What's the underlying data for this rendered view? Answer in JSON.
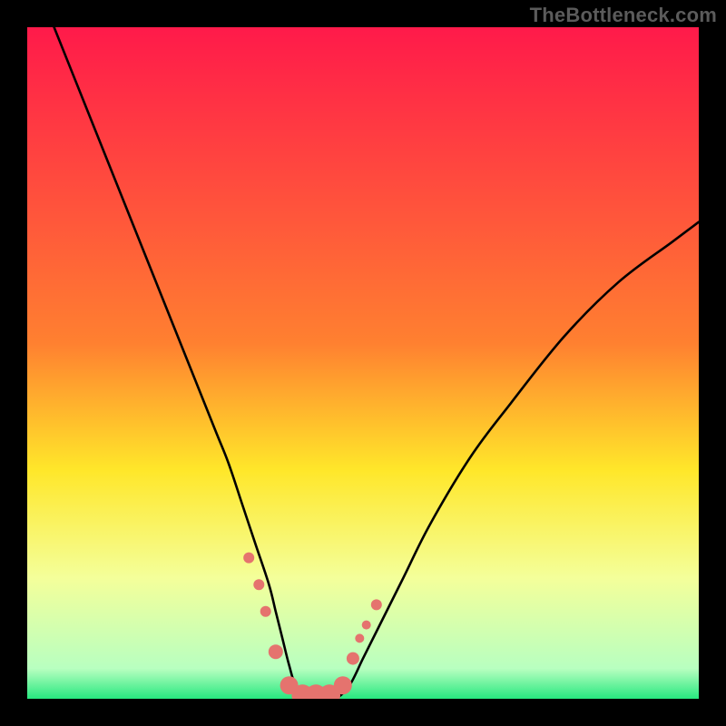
{
  "watermark": "TheBottleneck.com",
  "chart_data": {
    "type": "line",
    "title": "",
    "xlabel": "",
    "ylabel": "",
    "xlim": [
      0,
      100
    ],
    "ylim": [
      0,
      100
    ],
    "grid": false,
    "legend": false,
    "background_gradient": {
      "top": "#FF1A4A",
      "mid1": "#FF8030",
      "mid2": "#FFE72A",
      "low": "#F4FF9A",
      "bottom": "#27E87F"
    },
    "series": [
      {
        "name": "curve",
        "stroke": "#000000",
        "x": [
          4,
          8,
          12,
          16,
          20,
          24,
          28,
          30,
          32,
          34,
          36,
          37,
          38,
          39,
          40,
          42,
          44,
          45,
          46,
          48,
          50,
          52,
          56,
          60,
          66,
          72,
          80,
          88,
          96,
          100
        ],
        "y": [
          100,
          90,
          80,
          70,
          60,
          50,
          40,
          35,
          29,
          23,
          17,
          13,
          9,
          5,
          2,
          0,
          0,
          0,
          0,
          2,
          6,
          10,
          18,
          26,
          36,
          44,
          54,
          62,
          68,
          71
        ]
      },
      {
        "name": "markers",
        "type": "scatter",
        "color": "#E5736E",
        "x": [
          33,
          34.5,
          35.5,
          37,
          39,
          41,
          43,
          45,
          47,
          48.5,
          49.5,
          50.5,
          52
        ],
        "y": [
          21,
          17,
          13,
          7,
          2,
          0.5,
          0.5,
          0.5,
          2,
          6,
          9,
          11,
          14
        ],
        "r": [
          6,
          6,
          6,
          8,
          10,
          12,
          12,
          12,
          10,
          7,
          5,
          5,
          6
        ]
      }
    ]
  }
}
